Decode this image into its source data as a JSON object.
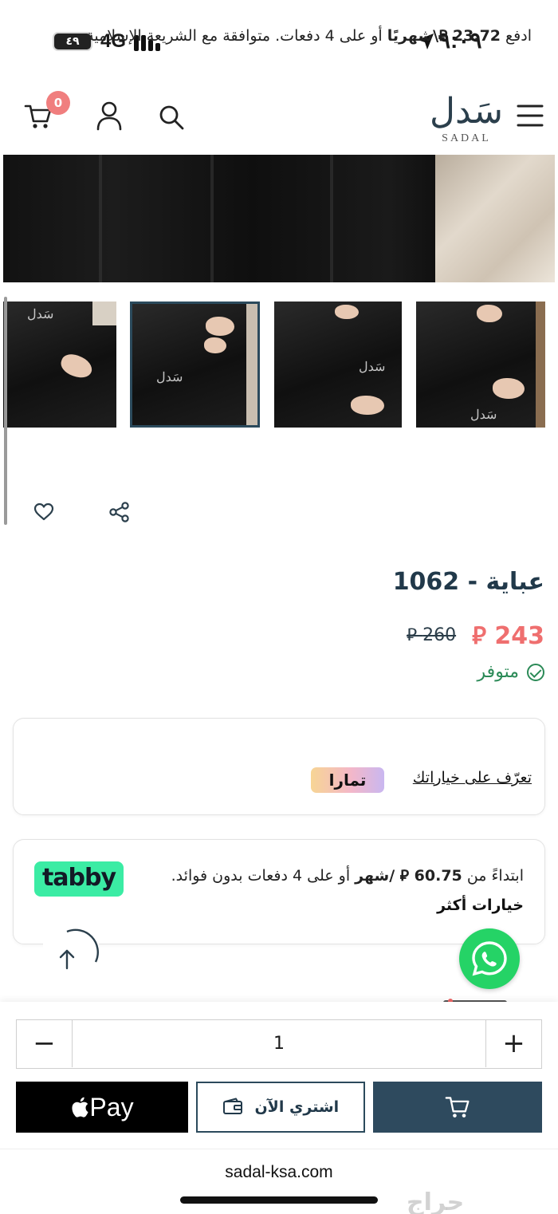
{
  "status_bar": {
    "battery": "٤٩",
    "network": "4G",
    "time": "٩:٠٩"
  },
  "header": {
    "cart_count": "0",
    "logo_ar": "سَدل",
    "logo_en": "SADAL"
  },
  "gallery": {
    "watermark": "سَدل",
    "selected_thumbnail_index": 1
  },
  "product": {
    "title": "عباية - 1062",
    "price": "243 ⃁",
    "old_price": "260 ⃁",
    "availability": "متوفر"
  },
  "tamara": {
    "text_prefix": "ادفع ",
    "amount": "23.72 ⃁\\شهريًا",
    "text_suffix": " أو على 4 دفعات. متوافقة مع الشريعة الإسلامية.",
    "link": "تعرّف على خياراتك",
    "logo": "تمارا"
  },
  "tabby": {
    "logo": "tabby",
    "text_prefix": "ابتداءً من ",
    "amount": "60.75 ⃁ /شهر",
    "text_suffix": " أو على 4 دفعات بدون فوائد.",
    "more": "خيارات أكثر"
  },
  "purchase": {
    "quantity": "1",
    "minus": "−",
    "plus": "+",
    "apple_pay": "Pay",
    "buy_now": "اشتري الآن"
  },
  "browser": {
    "url": "sadal-ksa.com"
  },
  "watermark": "حراج",
  "colors": {
    "primary": "#2e4a5e",
    "price_red": "#ef6f6f",
    "in_stock": "#2b8a57",
    "tabby_green": "#3beca4",
    "whatsapp": "#25d366"
  },
  "icons": [
    "cart-icon",
    "user-icon",
    "search-icon",
    "menu-icon",
    "heart-icon",
    "share-icon",
    "check-icon",
    "arrow-up-icon",
    "whatsapp-icon",
    "wallet-icon",
    "apple-icon"
  ]
}
